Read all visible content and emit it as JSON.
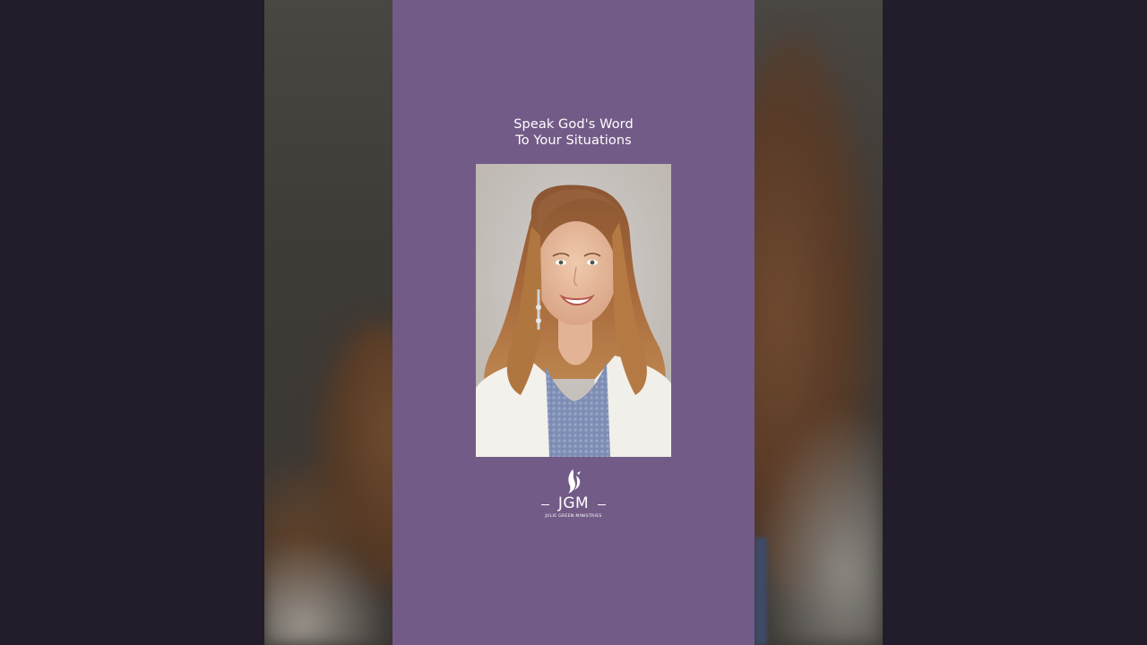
{
  "video": {
    "headline": {
      "line1": "Speak God's Word",
      "line2": "To Your Situations"
    },
    "portrait_alt": "portrait-photo",
    "logo": {
      "initials": "JGM",
      "subtitle": "JULIE GREEN MINISTRIES",
      "icon": "flame-dove-icon"
    }
  },
  "colors": {
    "page_background": "#221c2b",
    "column_background": "#735b87",
    "text": "#ffffff"
  }
}
